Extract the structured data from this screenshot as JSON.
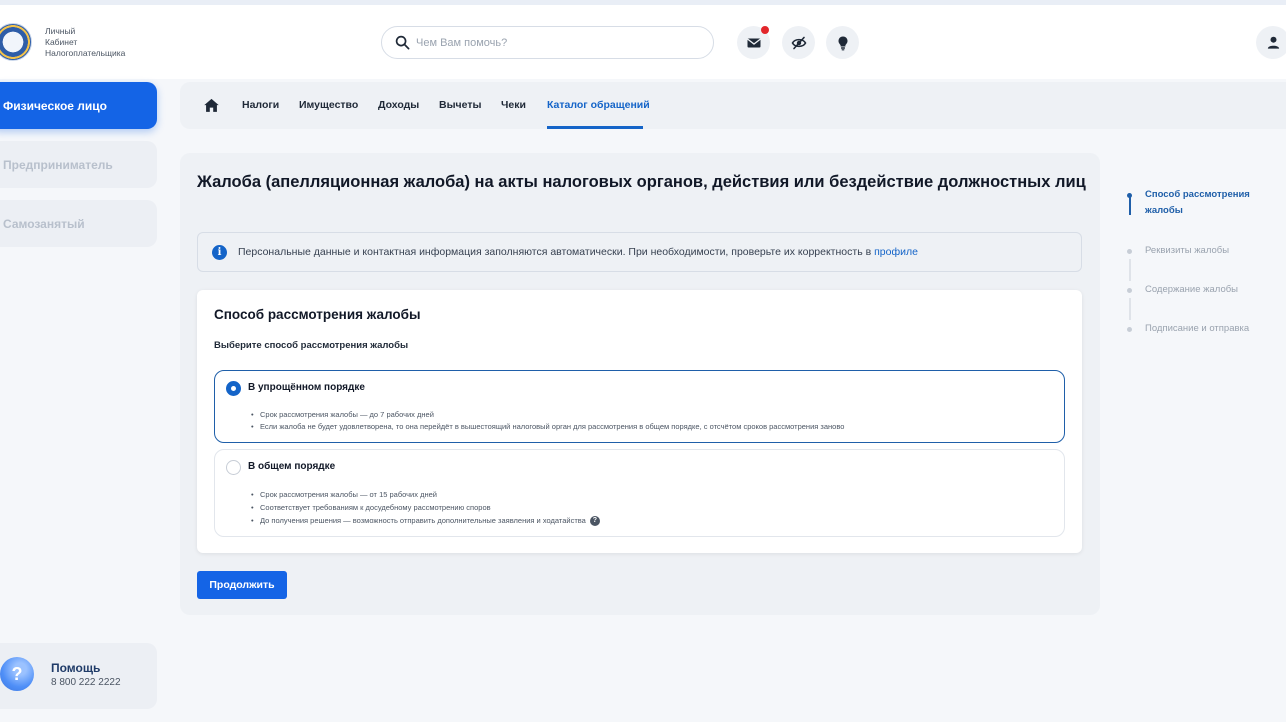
{
  "header": {
    "logo_text": [
      "Личный",
      "Кабинет",
      "Налогоплательщика"
    ],
    "search_placeholder": "Чем Вам помочь?",
    "icons": [
      "envelope-icon",
      "eye-off-icon",
      "lightbulb-icon",
      "user-icon"
    ],
    "notification_color": "#e2262b"
  },
  "sidebar": {
    "items": [
      {
        "label": "Физическое лицо",
        "active": true
      },
      {
        "label": "Предприниматель",
        "active": false
      },
      {
        "label": "Самозанятый",
        "active": false
      }
    ],
    "help": {
      "title": "Помощь",
      "phone": "8 800 222 2222"
    }
  },
  "nav": {
    "tabs": [
      {
        "label": "Налоги"
      },
      {
        "label": "Имущество"
      },
      {
        "label": "Доходы"
      },
      {
        "label": "Вычеты"
      },
      {
        "label": "Чеки"
      },
      {
        "label": "Каталог обращений",
        "active": true
      }
    ]
  },
  "main": {
    "title": "Жалоба (апелляционная жалоба) на акты налоговых органов, действия или бездействие должностных лиц",
    "info": {
      "text": "Персональные данные и контактная информация заполняются автоматически. При необходимости, проверьте их корректность в ",
      "link": "профиле"
    },
    "form": {
      "title": "Способ рассмотрения жалобы",
      "subtitle": "Выберите способ рассмотрения жалобы",
      "options": [
        {
          "title": "В упрощённом порядке",
          "selected": true,
          "bullets": [
            "Срок рассмотрения жалобы — до 7 рабочих дней",
            "Если жалоба не будет удовлетворена, то она перейдёт в вышестоящий налоговый орган для рассмотрения в общем порядке, с отсчётом сроков рассмотрения заново"
          ]
        },
        {
          "title": "В общем порядке",
          "selected": false,
          "bullets": [
            "Срок рассмотрения жалобы — от 15 рабочих дней",
            "Соответствует требованиям к досудебному рассмотрению споров",
            "До получения решения — возможность отправить дополнительные заявления и ходатайства"
          ]
        }
      ]
    },
    "continue_label": "Продолжить"
  },
  "steps": [
    {
      "label": "Способ рассмотрения жалобы",
      "active": true
    },
    {
      "label": "Реквизиты жалобы",
      "active": false
    },
    {
      "label": "Содержание жалобы",
      "active": false
    },
    {
      "label": "Подписание и отправка",
      "active": false
    }
  ],
  "colors": {
    "primary": "#1464e6",
    "link": "#1464c8",
    "accent_dark": "#1f5fa9"
  }
}
